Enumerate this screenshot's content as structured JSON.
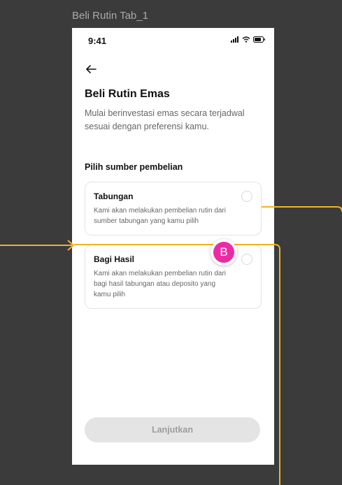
{
  "frame_label": "Beli Rutin Tab_1",
  "status_bar": {
    "time": "9:41"
  },
  "page": {
    "title": "Beli Rutin Emas",
    "subtitle": "Mulai berinvestasi emas secara terjadwal sesuai dengan preferensi kamu.",
    "section_label": "Pilih sumber pembelian"
  },
  "options": [
    {
      "title": "Tabungan",
      "description": "Kami akan melakukan pembelian rutin dari sumber tabungan yang kamu pilih",
      "selected": false
    },
    {
      "title": "Bagi Hasil",
      "description": "Kami akan melakukan pembelian rutin dari bagi hasil tabungan atau deposito yang kamu pilih",
      "selected": false
    }
  ],
  "cta": {
    "label": "Lanjutkan",
    "disabled": true
  },
  "flow_badge": {
    "letter": "B",
    "color": "#ec2aa6"
  },
  "colors": {
    "wire": "#f0b323",
    "canvas": "#3b3b3b",
    "screen": "#ffffff"
  }
}
